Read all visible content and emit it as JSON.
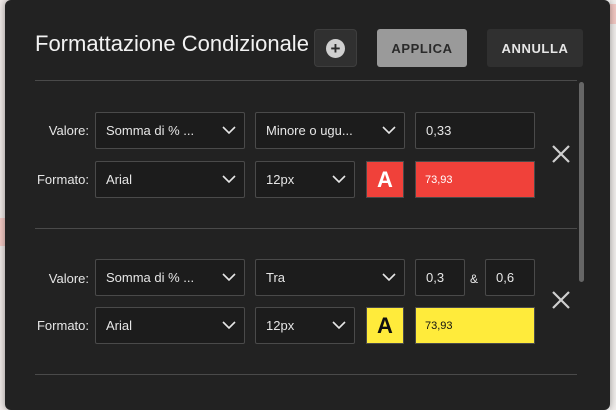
{
  "dialog": {
    "title": "Formattazione Condizionale",
    "apply_label": "APPLICA",
    "cancel_label": "ANNULLA",
    "add_icon": "plus-circle-icon"
  },
  "labels": {
    "value": "Valore:",
    "format": "Formato:"
  },
  "rules": [
    {
      "measure": "Somma di % ...",
      "operator": "Minore o ugu...",
      "value1": "0,33",
      "font": "Arial",
      "size": "12px",
      "color": "#f0413a",
      "swatch_glyph": "A",
      "preview_text": "73,93",
      "preview_text_color": "#ffffff"
    },
    {
      "measure": "Somma di % ...",
      "operator": "Tra",
      "value1": "0,3",
      "between_label": "&",
      "value2": "0,6",
      "font": "Arial",
      "size": "12px",
      "color": "#ffeb3b",
      "swatch_glyph": "A",
      "preview_text": "73,93",
      "preview_text_color": "#111111"
    }
  ],
  "icons": {
    "dropdown": "chevron-down-icon",
    "remove": "close-icon"
  }
}
